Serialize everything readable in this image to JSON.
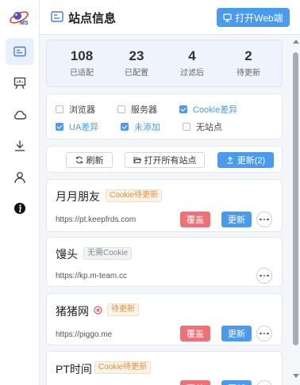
{
  "app": {
    "logo_text": "MS"
  },
  "sidebar": {
    "items": [
      {
        "icon": "site-info-icon",
        "active": true
      },
      {
        "icon": "presentation-icon",
        "active": false
      },
      {
        "icon": "cloud-icon",
        "active": false
      },
      {
        "icon": "download-icon",
        "active": false
      },
      {
        "icon": "user-icon",
        "active": false
      },
      {
        "icon": "info-icon",
        "active": false
      }
    ]
  },
  "header": {
    "title": "站点信息",
    "open_web_label": "打开Web端"
  },
  "stats": [
    {
      "value": "108",
      "label": "已适配"
    },
    {
      "value": "23",
      "label": "已配置"
    },
    {
      "value": "4",
      "label": "过滤后"
    },
    {
      "value": "2",
      "label": "待更新"
    }
  ],
  "filters": [
    {
      "label": "浏览器",
      "checked": false
    },
    {
      "label": "服务器",
      "checked": false
    },
    {
      "label": "Cookie差异",
      "checked": true
    },
    {
      "label": "UA差异",
      "checked": true
    },
    {
      "label": "未添加",
      "checked": true
    },
    {
      "label": "无站点",
      "checked": false
    }
  ],
  "actions": {
    "refresh_label": "刷新",
    "open_all_label": "打开所有站点",
    "update_label": "更新(2)"
  },
  "sites": [
    {
      "name": "月月朋友",
      "tag": "Cookie待更新",
      "url": "https://pt.keepfrds.com",
      "overwrite_label": "覆盖",
      "update_label": "更新"
    },
    {
      "name": "馒头",
      "tag": "无需Cookie",
      "url": "https://kp.m-team.cc"
    },
    {
      "name": "猪猪网",
      "tag": "待更新",
      "url": "https://piggo.me",
      "overwrite_label": "覆盖",
      "update_label": "更新"
    },
    {
      "name": "PT时间",
      "tag": "Cookie待更新",
      "url": "",
      "overwrite_label": "覆盖",
      "update_label": "更新"
    }
  ],
  "colors": {
    "primary": "#4a9bf0",
    "danger": "#f07078",
    "warning_tag": "#e6913a"
  }
}
